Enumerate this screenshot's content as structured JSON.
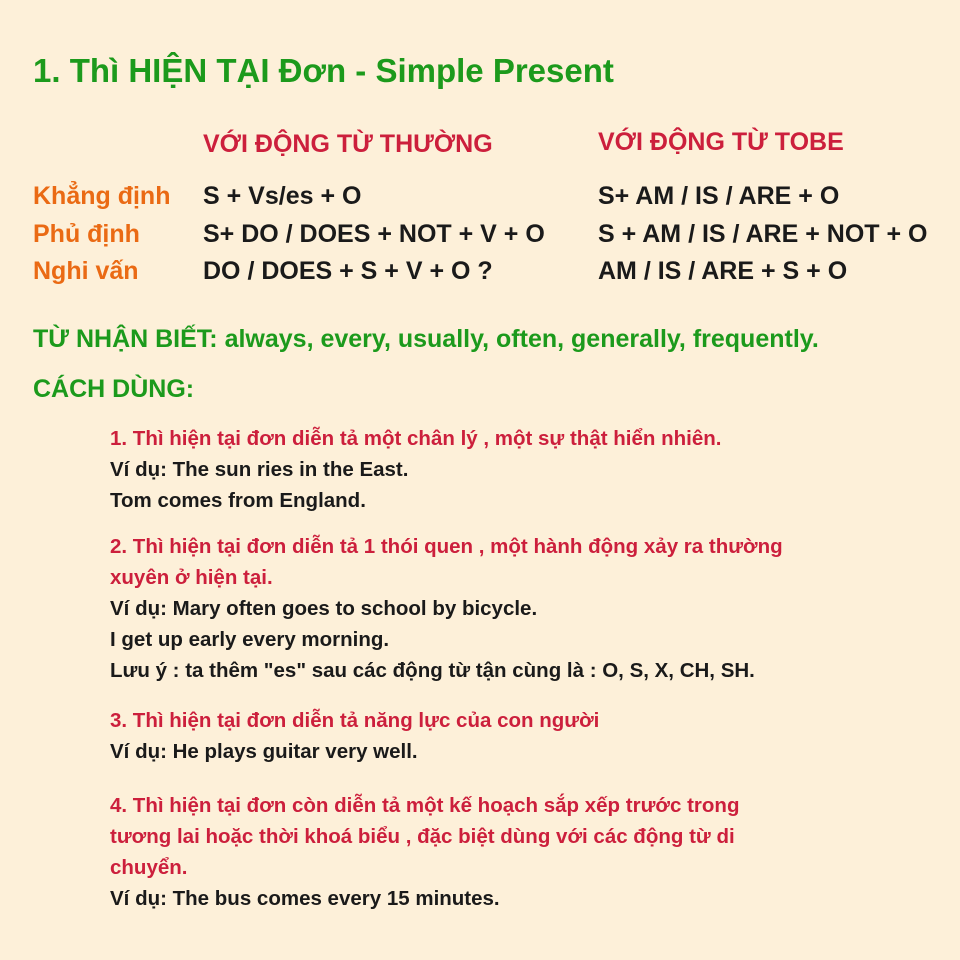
{
  "title": "1. Thì HIỆN TẠI Đơn - Simple Present",
  "table": {
    "headers": [
      "VỚI ĐỘNG TỪ THƯỜNG",
      "VỚI ĐỘNG TỪ TOBE"
    ],
    "rows": [
      {
        "label": "Khẳng định",
        "regular": "S + Vs/es + O",
        "tobe": "S+ AM / IS / ARE + O"
      },
      {
        "label": "Phủ định",
        "regular": "S+ DO / DOES + NOT + V + O",
        "tobe": "S + AM / IS / ARE + NOT + O"
      },
      {
        "label": "Nghi vấn",
        "regular": "DO / DOES + S + V + O ?",
        "tobe": "AM / IS / ARE + S + O"
      }
    ]
  },
  "signal_words": "TỪ NHẬN BIẾT: always, every, usually, often, generally, frequently.",
  "usage_heading": "CÁCH DÙNG:",
  "usages": [
    {
      "heading": [
        "1. Thì hiện tại đơn diễn tả một chân lý , một sự thật hiển nhiên."
      ],
      "lines": [
        "Ví dụ: The sun ries in the East.",
        "Tom comes from England."
      ]
    },
    {
      "heading": [
        "2. Thì hiện tại đơn diễn tả 1 thói quen , một hành động xảy ra thường",
        "xuyên ở hiện tại."
      ],
      "lines": [
        "Ví dụ: Mary often goes to school by bicycle.",
        "I get up early every morning.",
        "Lưu ý : ta thêm \"es\" sau các động từ tận cùng là : O, S, X, CH, SH."
      ]
    },
    {
      "heading": [
        "3. Thì hiện tại đơn diễn tả năng lực của con người"
      ],
      "lines": [
        "Ví dụ: He plays guitar very well."
      ]
    },
    {
      "heading": [
        "4. Thì hiện tại đơn còn diễn tả một kế hoạch sắp xếp trước trong",
        "tương lai hoặc thời khoá biểu , đặc biệt dùng với các động từ di",
        "chuyển."
      ],
      "lines": [
        "Ví dụ: The bus comes every 15 minutes."
      ]
    }
  ],
  "colors": {
    "background": "#fdf0d9",
    "green": "#1c9a1c",
    "red": "#cc1f3c",
    "orange": "#ea6a14",
    "text": "#1a1a1a"
  }
}
